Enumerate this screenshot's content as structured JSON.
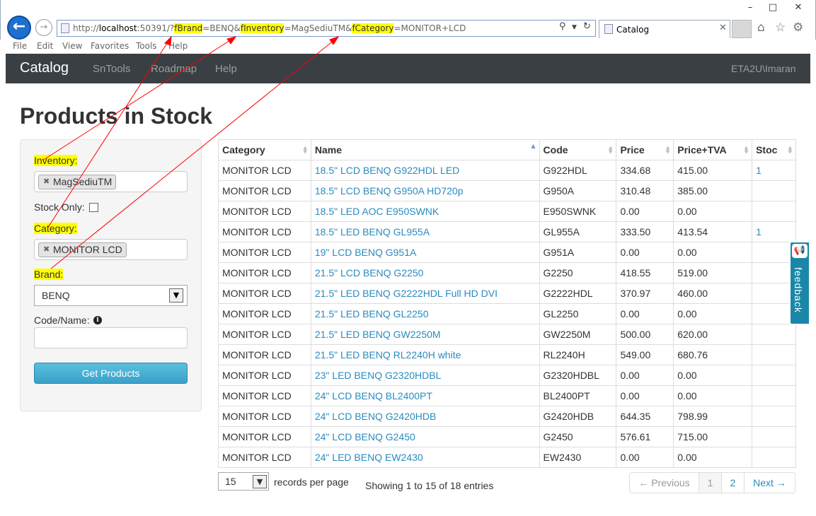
{
  "browser": {
    "url_prefix": "http://",
    "url_host": "localhost",
    "url_port_path": ":50391/?",
    "url_param1": "fBrand",
    "url_val1": "=BENQ&",
    "url_param2": "fInventory",
    "url_val2": "=MagSediuTM&",
    "url_param3": "fCategory",
    "url_val3": "=MONITOR+LCD",
    "tab_title": "Catalog",
    "menu": [
      "File",
      "Edit",
      "View",
      "Favorites",
      "Tools",
      "Help"
    ],
    "icons": {
      "back": "back-arrow-icon",
      "forward": "forward-arrow-icon",
      "search": "search-icon",
      "refresh": "refresh-icon",
      "home": "home-icon",
      "favorites": "star-icon",
      "settings": "gear-icon"
    }
  },
  "navbar": {
    "brand": "Catalog",
    "links": [
      "SnTools",
      "Roadmap",
      "Help"
    ],
    "user": "ETA2U\\Imaran"
  },
  "page": {
    "title": "Products in Stock"
  },
  "filters": {
    "inventory_label": "Inventory:",
    "inventory_chip": "MagSediuTM",
    "stock_only_label": "Stock Only:",
    "category_label": "Category:",
    "category_chip": "MONITOR LCD",
    "brand_label": "Brand:",
    "brand_value": "BENQ",
    "code_name_label": "Code/Name:",
    "code_name_value": "",
    "submit_label": "Get Products"
  },
  "table": {
    "columns": [
      "Category",
      "Name",
      "Code",
      "Price",
      "Price+TVA",
      "Stoc"
    ],
    "rows": [
      [
        "MONITOR LCD",
        "18.5\" LCD BENQ G922HDL LED",
        "G922HDL",
        "334.68",
        "415.00",
        "1"
      ],
      [
        "MONITOR LCD",
        "18.5\" LCD BENQ G950A HD720p",
        "G950A",
        "310.48",
        "385.00",
        ""
      ],
      [
        "MONITOR LCD",
        "18.5\" LED AOC E950SWNK",
        "E950SWNK",
        "0.00",
        "0.00",
        ""
      ],
      [
        "MONITOR LCD",
        "18.5\" LED BENQ GL955A",
        "GL955A",
        "333.50",
        "413.54",
        "1"
      ],
      [
        "MONITOR LCD",
        "19\" LCD BENQ G951A",
        "G951A",
        "0.00",
        "0.00",
        ""
      ],
      [
        "MONITOR LCD",
        "21.5\" LCD BENQ G2250",
        "G2250",
        "418.55",
        "519.00",
        ""
      ],
      [
        "MONITOR LCD",
        "21.5\" LED BENQ G2222HDL Full HD DVI",
        "G2222HDL",
        "370.97",
        "460.00",
        ""
      ],
      [
        "MONITOR LCD",
        "21.5\" LED BENQ GL2250",
        "GL2250",
        "0.00",
        "0.00",
        ""
      ],
      [
        "MONITOR LCD",
        "21.5\" LED BENQ GW2250M",
        "GW2250M",
        "500.00",
        "620.00",
        ""
      ],
      [
        "MONITOR LCD",
        "21.5\" LED BENQ RL2240H white",
        "RL2240H",
        "549.00",
        "680.76",
        ""
      ],
      [
        "MONITOR LCD",
        "23\" LED BENQ G2320HDBL",
        "G2320HDBL",
        "0.00",
        "0.00",
        ""
      ],
      [
        "MONITOR LCD",
        "24\" LCD BENQ BL2400PT",
        "BL2400PT",
        "0.00",
        "0.00",
        ""
      ],
      [
        "MONITOR LCD",
        "24\" LCD BENQ G2420HDB",
        "G2420HDB",
        "644.35",
        "798.99",
        ""
      ],
      [
        "MONITOR LCD",
        "24\" LCD BENQ G2450",
        "G2450",
        "576.61",
        "715.00",
        ""
      ],
      [
        "MONITOR LCD",
        "24\" LED BENQ EW2430",
        "EW2430",
        "0.00",
        "0.00",
        ""
      ]
    ]
  },
  "table_footer": {
    "page_size": "15",
    "records_per_page": "records per page",
    "info": "Showing 1 to 15 of 18 entries",
    "prev": "← Previous",
    "pages": [
      "1",
      "2"
    ],
    "next": "Next →"
  },
  "feedback": {
    "label": "feedback"
  },
  "colors": {
    "navbar": "#3a3f44",
    "link": "#2a8bbf",
    "highlight": "#ffff00",
    "annotation": "#ff0000",
    "button": "#46aad0"
  }
}
